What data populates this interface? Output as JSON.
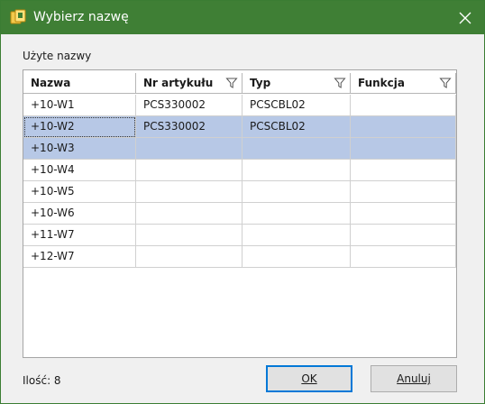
{
  "window": {
    "title": "Wybierz nazwę",
    "title_color": "#3f7f35",
    "icon": "dialog-app-icon"
  },
  "section_label": "Użyte nazwy",
  "table": {
    "columns": [
      {
        "label": "Nazwa",
        "filter": false
      },
      {
        "label": "Nr artykułu",
        "filter": true
      },
      {
        "label": "Typ",
        "filter": true
      },
      {
        "label": "Funkcja",
        "filter": true
      }
    ],
    "rows": [
      {
        "nazwa": "+10-W1",
        "nr_artykulu": "PCS330002",
        "typ": "PCSCBL02",
        "funkcja": "",
        "selected": false
      },
      {
        "nazwa": "+10-W2",
        "nr_artykulu": "PCS330002",
        "typ": "PCSCBL02",
        "funkcja": "",
        "selected": true
      },
      {
        "nazwa": "+10-W3",
        "nr_artykulu": "",
        "typ": "",
        "funkcja": "",
        "selected": true
      },
      {
        "nazwa": "+10-W4",
        "nr_artykulu": "",
        "typ": "",
        "funkcja": "",
        "selected": false
      },
      {
        "nazwa": "+10-W5",
        "nr_artykulu": "",
        "typ": "",
        "funkcja": "",
        "selected": false
      },
      {
        "nazwa": "+10-W6",
        "nr_artykulu": "",
        "typ": "",
        "funkcja": "",
        "selected": false
      },
      {
        "nazwa": "+11-W7",
        "nr_artykulu": "",
        "typ": "",
        "funkcja": "",
        "selected": false
      },
      {
        "nazwa": "+12-W7",
        "nr_artykulu": "",
        "typ": "",
        "funkcja": "",
        "selected": false
      }
    ],
    "selection_color": "#b7c8e6"
  },
  "footer": {
    "count_label": "Ilość: 8",
    "ok_label": "OK",
    "cancel_label": "Anuluj"
  }
}
